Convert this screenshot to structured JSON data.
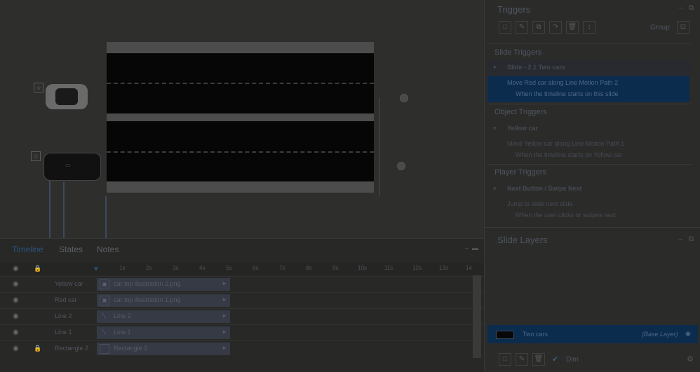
{
  "timeline": {
    "tabs": [
      {
        "label": "Timeline"
      },
      {
        "label": "States"
      },
      {
        "label": "Notes"
      }
    ],
    "ticks": [
      "1s",
      "2s",
      "3s",
      "4s",
      "5s",
      "6s",
      "7s",
      "8s",
      "9s",
      "10s",
      "11s",
      "12s",
      "13s",
      "14"
    ],
    "rows": [
      {
        "name": "Yellow car",
        "object": "car top illustration 2.png",
        "icon": "image-icon"
      },
      {
        "name": "Red car",
        "object": "car top illustration 1.png",
        "icon": "image-icon"
      },
      {
        "name": "Line 2",
        "object": "Line 2",
        "icon": "line-icon"
      },
      {
        "name": "Line 1",
        "object": "Line 1",
        "icon": "line-icon"
      },
      {
        "name": "Rectangle 2",
        "object": "Rectangle 2",
        "icon": "rectangle-icon"
      }
    ]
  },
  "triggers": {
    "title": "Triggers",
    "group_label": "Group",
    "slide_triggers": {
      "heading": "Slide Triggers",
      "slide": "Slide - 2.1 Two cars",
      "action": "Move Red car along Line Motion Path 2",
      "when": "When the timeline starts on this slide"
    },
    "object_triggers": {
      "heading": "Object Triggers",
      "object": "Yellow car",
      "action": "Move Yellow car along Line Motion Path 1",
      "when": "When the timeline starts on Yellow car"
    },
    "player_triggers": {
      "heading": "Player Triggers",
      "object": "Next Button / Swipe Next",
      "action": "Jump to slide next slide",
      "when": "When the user clicks or swipes next"
    }
  },
  "layers": {
    "title": "Slide Layers",
    "base_name": "Two cars",
    "base_tag": "(Base Layer)",
    "dim_label": "Dim"
  }
}
